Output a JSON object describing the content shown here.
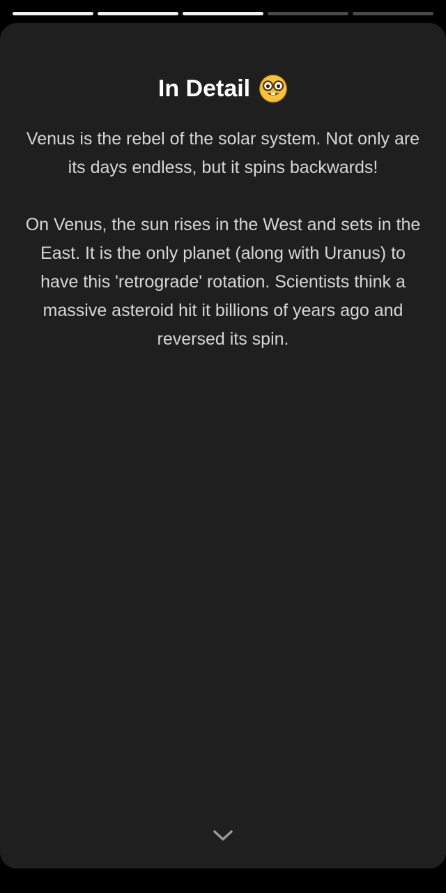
{
  "story": {
    "segments_total": 5,
    "segments_completed": 3
  },
  "card": {
    "title": "In Detail",
    "title_icon": "nerd-face-emoji",
    "paragraphs": [
      "Venus is the rebel of the solar system. Not only are its days endless, but it spins backwards!",
      "On Venus, the sun rises in the West and sets in the East. It is the only planet (along with Uranus) to have this 'retrograde' rotation. Scientists think a massive asteroid hit it billions of years ago and reversed its spin."
    ],
    "next_icon": "chevron-down-icon"
  },
  "colors": {
    "background": "#000000",
    "card": "#1f1f1f",
    "title": "#ffffff",
    "body_text": "#d6d6d6",
    "progress_done": "#f2f2f2",
    "progress_pending": "#4a4a4a"
  }
}
